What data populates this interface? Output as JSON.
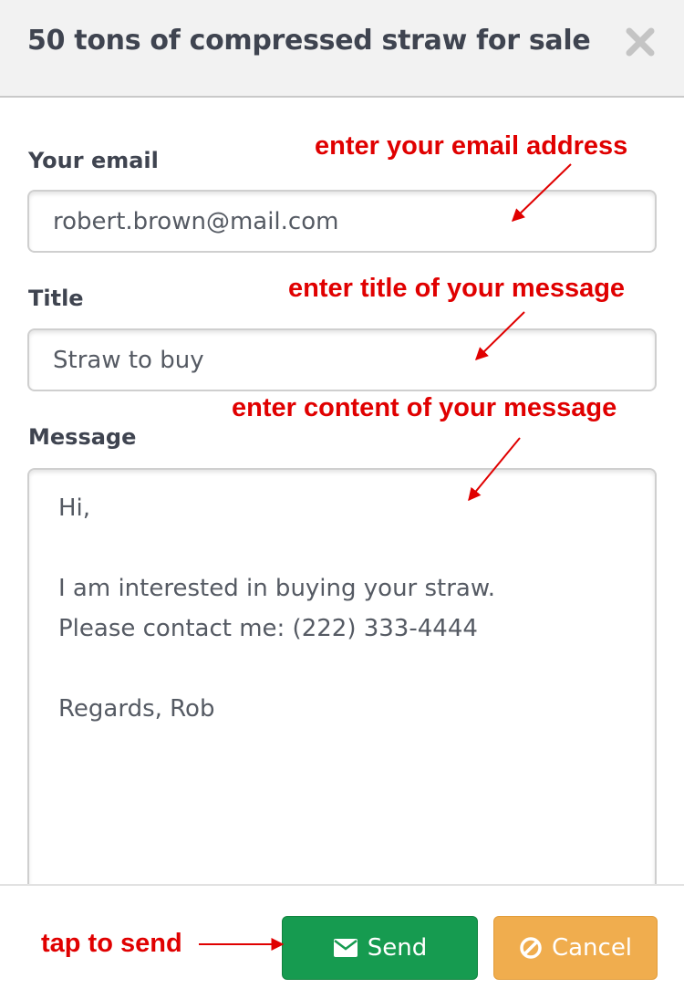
{
  "modal": {
    "title": "50 tons of compressed straw for sale"
  },
  "form": {
    "email": {
      "label": "Your email",
      "value": "robert.brown@mail.com"
    },
    "title": {
      "label": "Title",
      "value": "Straw to buy"
    },
    "message": {
      "label": "Message",
      "value": "Hi,\n\nI am interested in buying your straw.\nPlease contact me: (222) 333-4444\n\nRegards, Rob"
    }
  },
  "buttons": {
    "send": {
      "label": "Send",
      "icon": "envelope-icon",
      "color": "#169b50"
    },
    "cancel": {
      "label": "Cancel",
      "icon": "ban-icon",
      "color": "#f0ad4e"
    }
  },
  "annotations": {
    "email": "enter your email address",
    "title": "enter title of your message",
    "message": "enter content of your message",
    "send": "tap to send",
    "color": "#e00000"
  }
}
